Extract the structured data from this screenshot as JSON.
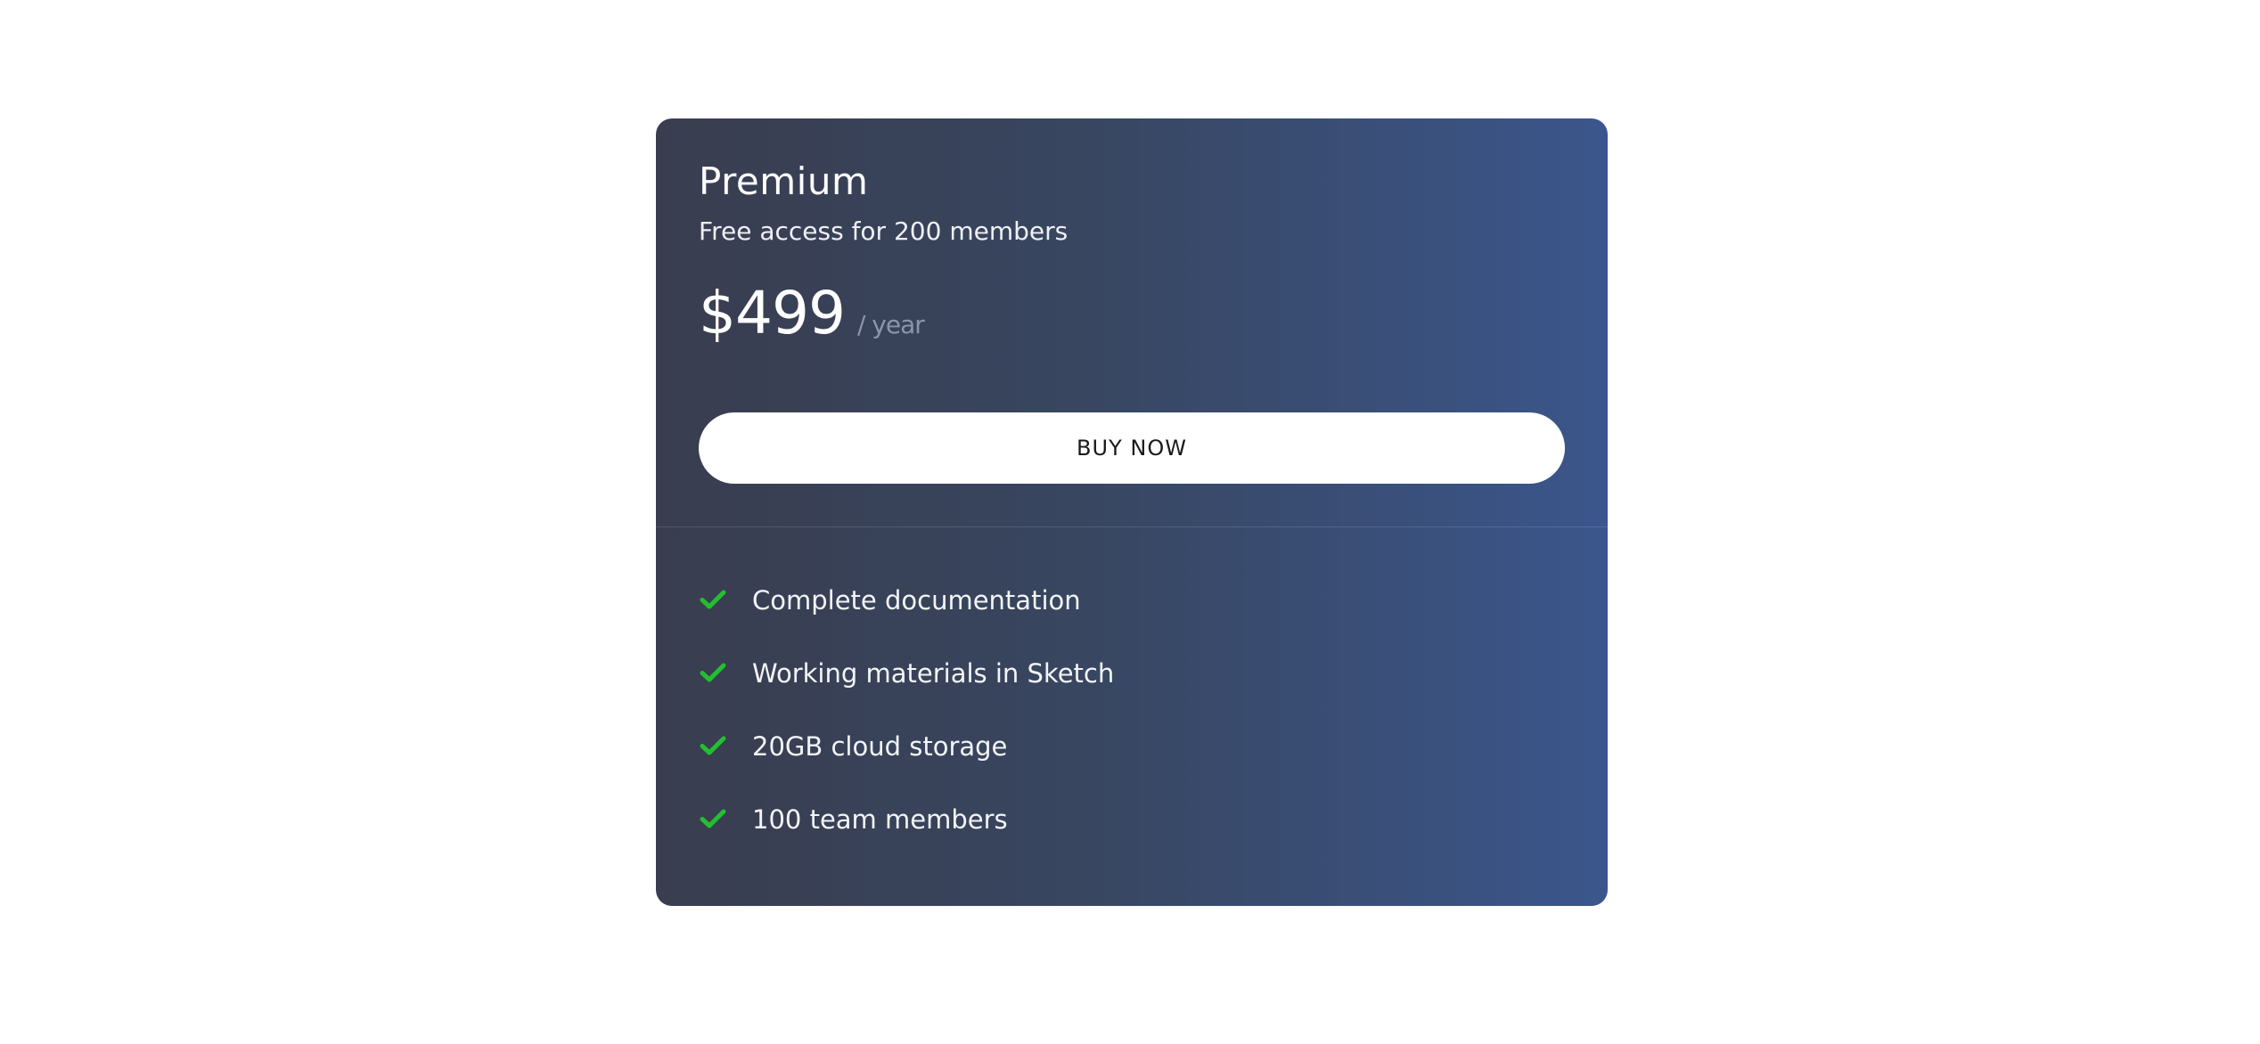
{
  "plan": {
    "name": "Premium",
    "description": "Free access for 200 members",
    "price": "$499",
    "period": "/ year",
    "buy_label": "BUY NOW"
  },
  "features": [
    {
      "label": "Complete documentation",
      "icon": "check-icon"
    },
    {
      "label": "Working materials in Sketch",
      "icon": "check-icon"
    },
    {
      "label": "20GB cloud storage",
      "icon": "check-icon"
    },
    {
      "label": "100 team members",
      "icon": "check-icon"
    }
  ],
  "colors": {
    "card_gradient_start": "#393d4f",
    "card_gradient_end": "#3b568c",
    "check": "#22c02f",
    "button_bg": "#ffffff"
  }
}
